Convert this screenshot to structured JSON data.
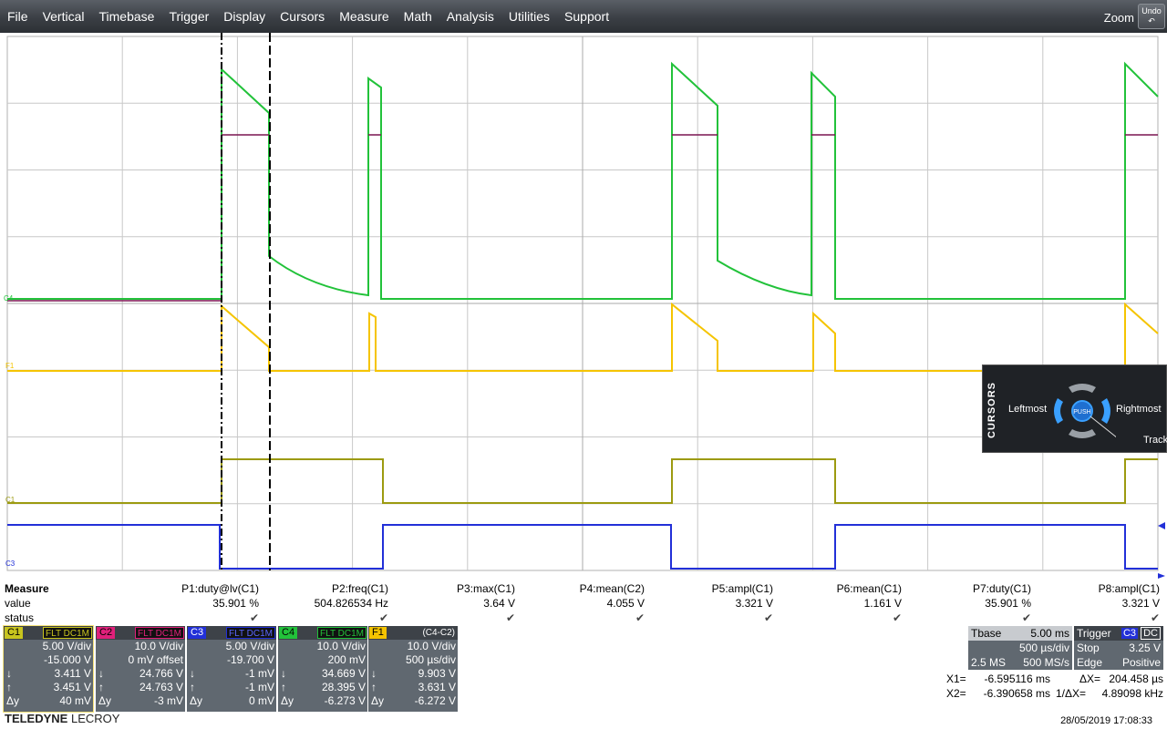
{
  "menu": [
    "File",
    "Vertical",
    "Timebase",
    "Trigger",
    "Display",
    "Cursors",
    "Measure",
    "Math",
    "Analysis",
    "Utilities",
    "Support"
  ],
  "zoom_label": "Zoom",
  "undo_label": "Undo",
  "trace_labels": {
    "c4": "C4",
    "c2": "C2",
    "f1": "F1",
    "c1": "C1",
    "c3": "C3"
  },
  "colors": {
    "c1": "#c8c41e",
    "c2": "#e0207a",
    "c3": "#2230d8",
    "c4": "#22c23a",
    "f1": "#f5c400",
    "grid": "#c8c8c8",
    "panel": "#606870"
  },
  "cursors_popup": {
    "title": "CURSORS",
    "left": "Leftmost",
    "right": "Rightmost",
    "center": "PUSH",
    "track": "Track"
  },
  "measure": {
    "header": "Measure",
    "row_value": "value",
    "row_status": "status",
    "params": [
      {
        "name": "P1:duty@lv(C1)",
        "value": "35.901 %",
        "status": "✔"
      },
      {
        "name": "P2:freq(C1)",
        "value": "504.826534 Hz",
        "status": "✔"
      },
      {
        "name": "P3:max(C1)",
        "value": "3.64 V",
        "status": "✔"
      },
      {
        "name": "P4:mean(C2)",
        "value": "4.055 V",
        "status": "✔"
      },
      {
        "name": "P5:ampl(C1)",
        "value": "3.321 V",
        "status": "✔"
      },
      {
        "name": "P6:mean(C1)",
        "value": "1.161 V",
        "status": "✔"
      },
      {
        "name": "P7:duty(C1)",
        "value": "35.901 %",
        "status": "✔"
      },
      {
        "name": "P8:ampl(C1)",
        "value": "3.321 V",
        "status": "✔"
      }
    ]
  },
  "channels": [
    {
      "tag": "C1",
      "cpl": "FLT DC1M",
      "l1": "5.00 V/div",
      "l2": "-15.000 V",
      "down": "3.411 V",
      "up": "3.451 V",
      "dy": "40 mV"
    },
    {
      "tag": "C2",
      "cpl": "FLT DC1M",
      "l1": "10.0 V/div",
      "l2": "0 mV offset",
      "down": "24.766 V",
      "up": "24.763 V",
      "dy": "-3 mV"
    },
    {
      "tag": "C3",
      "cpl": "FLT DC1M",
      "l1": "5.00 V/div",
      "l2": "-19.700 V",
      "down": "-1 mV",
      "up": "-1 mV",
      "dy": "0 mV"
    },
    {
      "tag": "C4",
      "cpl": "FLT DC1M",
      "l1": "10.0 V/div",
      "l2": "200 mV",
      "down": "34.669 V",
      "up": "28.395 V",
      "dy": "-6.273 V"
    },
    {
      "tag": "F1",
      "cpl": "(C4-C2)",
      "l1": "10.0 V/div",
      "l2": "500 µs/div",
      "down": "9.903 V",
      "up": "3.631 V",
      "dy": "-6.272 V"
    }
  ],
  "dy_label": "Δy",
  "timebase": {
    "label": "Tbase",
    "delay": "5.00 ms",
    "div": "500 µs/div",
    "samples": "2.5 MS",
    "rate": "500 MS/s"
  },
  "trigger": {
    "label": "Trigger",
    "src": "C3",
    "cpl": "DC",
    "mode": "Stop",
    "level": "3.25 V",
    "type": "Edge",
    "slope": "Positive"
  },
  "cursor_readout": {
    "x1_label": "X1=",
    "x1": "-6.595116 ms",
    "dx_label": "ΔX=",
    "dx": "204.458 µs",
    "x2_label": "X2=",
    "x2": "-6.390658 ms",
    "inv_label": "1/ΔX=",
    "inv": "4.89098 kHz"
  },
  "logo_main": "TELEDYNE",
  "logo_sub": "LECROY",
  "datetime": "28/05/2019 17:08:33"
}
